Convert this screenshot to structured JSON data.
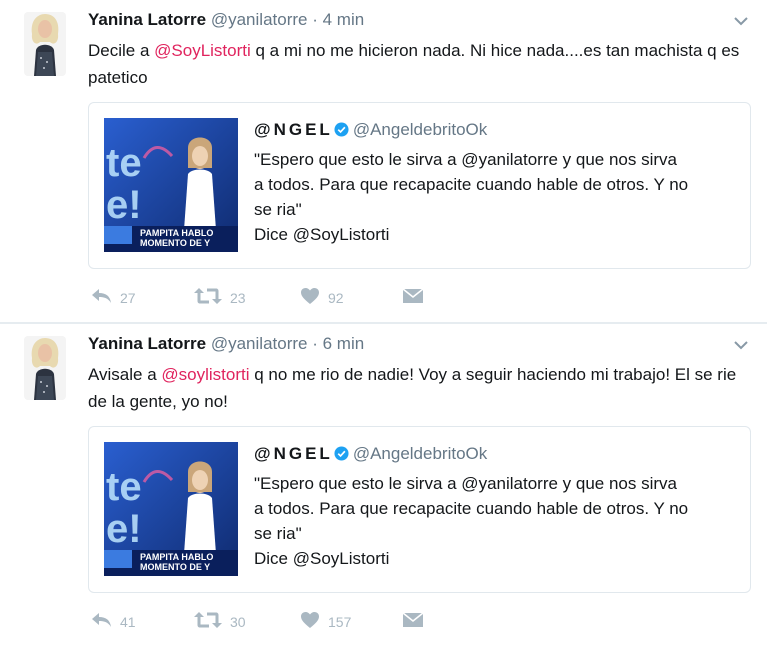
{
  "tweets": [
    {
      "name": "Yanina Latorre",
      "handle": "@yanilatorre",
      "dot": "·",
      "time": "4 min",
      "text_before": "Decile a ",
      "mention": "@SoyListorti",
      "text_after": " q a mi no me hicieron nada. Ni hice nada....es tan machista q es patetico",
      "quote": {
        "name": "@NGEL",
        "handle": "@AngeldebritoOk",
        "lines": [
          "\"Espero que esto le sirva a @yanilatorre y que nos sirva",
          "a todos. Para que recapacite cuando hable de otros. Y no",
          "se ria\"",
          "Dice @SoyListorti"
        ],
        "thumb_caption_1": "PAMPITA HABLO",
        "thumb_caption_2": "MOMENTO DE Y"
      },
      "replies": "27",
      "retweets": "23",
      "likes": "92"
    },
    {
      "name": "Yanina Latorre",
      "handle": "@yanilatorre",
      "dot": "·",
      "time": "6 min",
      "text_before": "Avisale a ",
      "mention": "@soylistorti",
      "text_after": " q no me rio de nadie! Voy a seguir haciendo mi trabajo! El se rie de la gente, yo no!",
      "quote": {
        "name": "@NGEL",
        "handle": "@AngeldebritoOk",
        "lines": [
          "\"Espero que esto le sirva a @yanilatorre y que nos sirva",
          "a todos. Para que recapacite cuando hable de otros. Y no",
          "se ria\"",
          "Dice @SoyListorti"
        ],
        "thumb_caption_1": "PAMPITA HABLO",
        "thumb_caption_2": "MOMENTO DE Y"
      },
      "replies": "41",
      "retweets": "30",
      "likes": "157"
    }
  ],
  "colors": {
    "mention": "#e0245e",
    "muted": "#657786",
    "action_icon": "#aab8c2",
    "verified": "#1da1f2"
  },
  "icons": [
    "chevron-down-icon",
    "verified-icon",
    "reply-icon",
    "retweet-icon",
    "like-icon",
    "direct-message-icon"
  ]
}
